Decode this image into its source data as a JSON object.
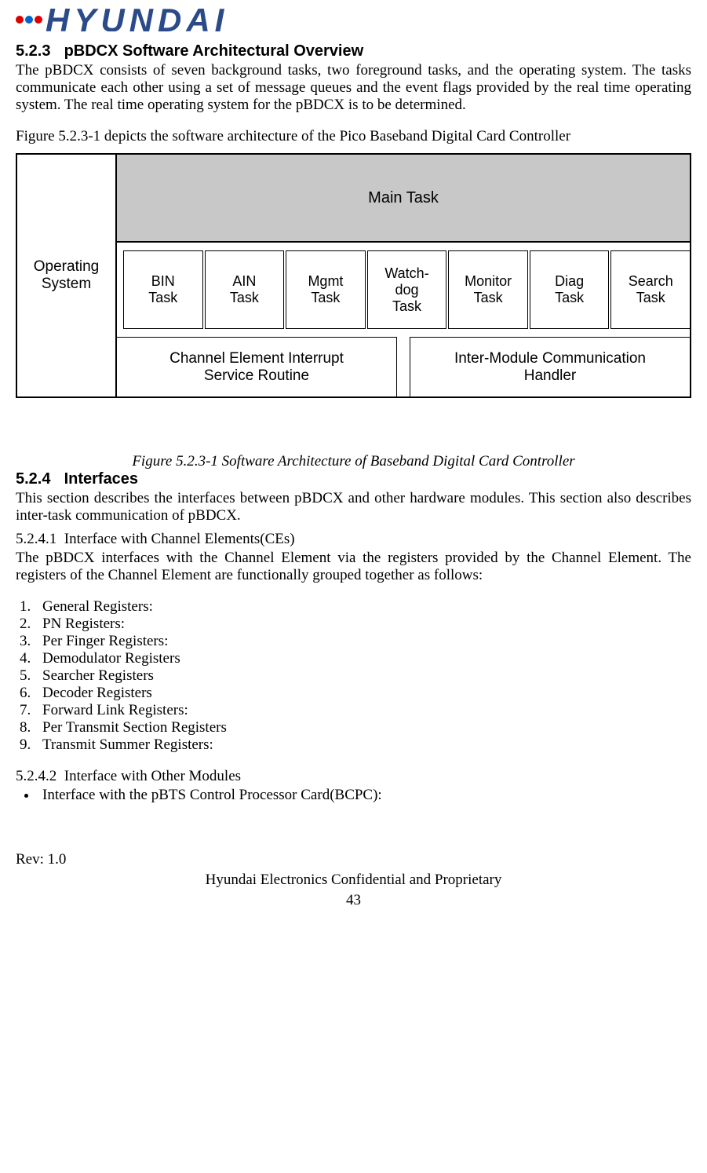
{
  "header": {
    "logo_text": "HYUNDAI"
  },
  "section_523": {
    "number": "5.2.3",
    "title": "pBDCX Software Architectural Overview",
    "para1": "The pBDCX consists of seven background tasks, two foreground tasks, and the operating system. The tasks communicate each other using a set of message queues and the event flags provided by the real time operating system. The real time operating system for the pBDCX is to be determined.",
    "para2": "Figure 5.2.3-1 depicts the software architecture of the Pico Baseband Digital Card Controller"
  },
  "diagram": {
    "os": "Operating\nSystem",
    "main": "Main Task",
    "tasks": [
      "BIN\nTask",
      "AIN\nTask",
      "Mgmt\nTask",
      "Watch-\ndog\nTask",
      "Monitor\nTask",
      "Diag\nTask",
      "Search\nTask"
    ],
    "bottom_left": "Channel Element Interrupt\nService Routine",
    "bottom_right": "Inter-Module Communication\nHandler",
    "caption": "Figure 5.2.3-1 Software Architecture of Baseband Digital Card Controller"
  },
  "section_524": {
    "number": "5.2.4",
    "title": "Interfaces",
    "intro": "This section describes the interfaces between pBDCX and other hardware modules. This section also describes inter-task communication of pBDCX.",
    "sub1_num": "5.2.4.1",
    "sub1_title": "Interface with Channel Elements(CEs)",
    "sub1_body": "The pBDCX interfaces with the Channel Element via the registers provided by the Channel Element. The registers of the Channel Element are functionally grouped together as follows:",
    "registers": [
      "General Registers:",
      "PN Registers:",
      "Per Finger Registers:",
      "Demodulator Registers",
      "Searcher Registers",
      "Decoder Registers",
      "Forward Link Registers:",
      "Per Transmit Section Registers",
      "Transmit Summer Registers:"
    ],
    "sub2_num": "5.2.4.2",
    "sub2_title": "Interface with Other Modules",
    "sub2_bullet": "Interface with the pBTS Control Processor Card(BCPC):"
  },
  "footer": {
    "rev": "Rev: 1.0",
    "conf": "Hyundai Electronics Confidential and Proprietary",
    "page": "43"
  }
}
